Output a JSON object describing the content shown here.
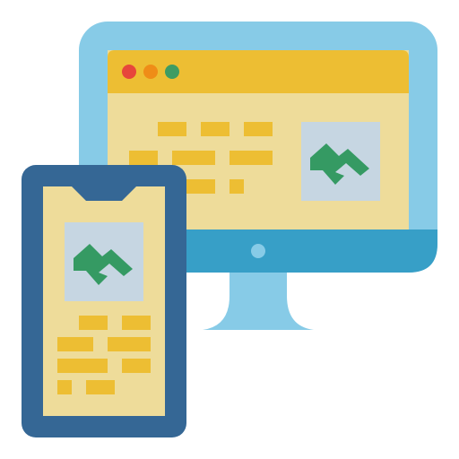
{
  "illustration": {
    "kind": "responsive-design-icon",
    "colors": {
      "monitor_frame": "#87CBE7",
      "monitor_chin": "#379FC7",
      "monitor_button": "#87CBE7",
      "stand": "#87CBE7",
      "browser_bar": "#EDBE33",
      "browser_dot_red": "#E7463B",
      "browser_dot_orange": "#EF8D17",
      "browser_dot_green": "#3E9C63",
      "screen_bg": "#EEDC9A",
      "text_line": "#EDBE33",
      "image_bg": "#C6D6E2",
      "image_glyph": "#359A63",
      "phone_frame": "#356795"
    },
    "icons": [
      "desktop-monitor-icon",
      "smartphone-icon",
      "image-placeholder-icon"
    ]
  }
}
